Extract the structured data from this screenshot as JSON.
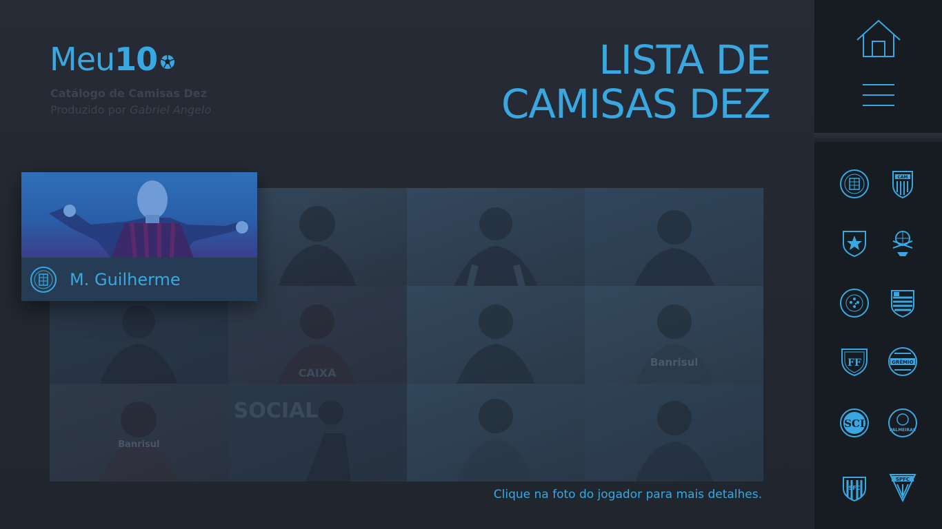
{
  "logo": {
    "text": "Meu",
    "bold": "10"
  },
  "header": {
    "subtitle": "Catálogo de Camisas Dez",
    "credit_prefix": "Produzido por",
    "credit_name": "Gabriel Angelo"
  },
  "title": {
    "line1": "LISTA DE",
    "line2": "CAMISAS DEZ"
  },
  "featured": {
    "name": "M. Guilherme"
  },
  "hint": "Clique na foto do jogador para mais detalhes.",
  "grid_sponsors": [
    "CAIXA",
    "CAIXA",
    "Banrisul",
    "SOCIAL",
    "Banrisul"
  ],
  "sidebar": {
    "clubs": [
      {
        "name": "Athletico Paranaense",
        "abbr": "CAP"
      },
      {
        "name": "Atlético Mineiro",
        "abbr": "CAM"
      },
      {
        "name": "Botafogo",
        "abbr": "BFR"
      },
      {
        "name": "Corinthians",
        "abbr": "SCCP"
      },
      {
        "name": "Cruzeiro",
        "abbr": "CEC"
      },
      {
        "name": "Flamengo",
        "abbr": "CRF"
      },
      {
        "name": "Fluminense",
        "abbr": "FFC"
      },
      {
        "name": "Grêmio",
        "abbr": "GRÊMIO"
      },
      {
        "name": "Internacional",
        "abbr": "SCI"
      },
      {
        "name": "Palmeiras",
        "abbr": "SEP"
      },
      {
        "name": "Santos",
        "abbr": "SFC"
      },
      {
        "name": "São Paulo",
        "abbr": "SPFC"
      }
    ]
  },
  "colors": {
    "accent": "#3aa8e0",
    "background": "#222731",
    "sidebar": "#171b22"
  }
}
